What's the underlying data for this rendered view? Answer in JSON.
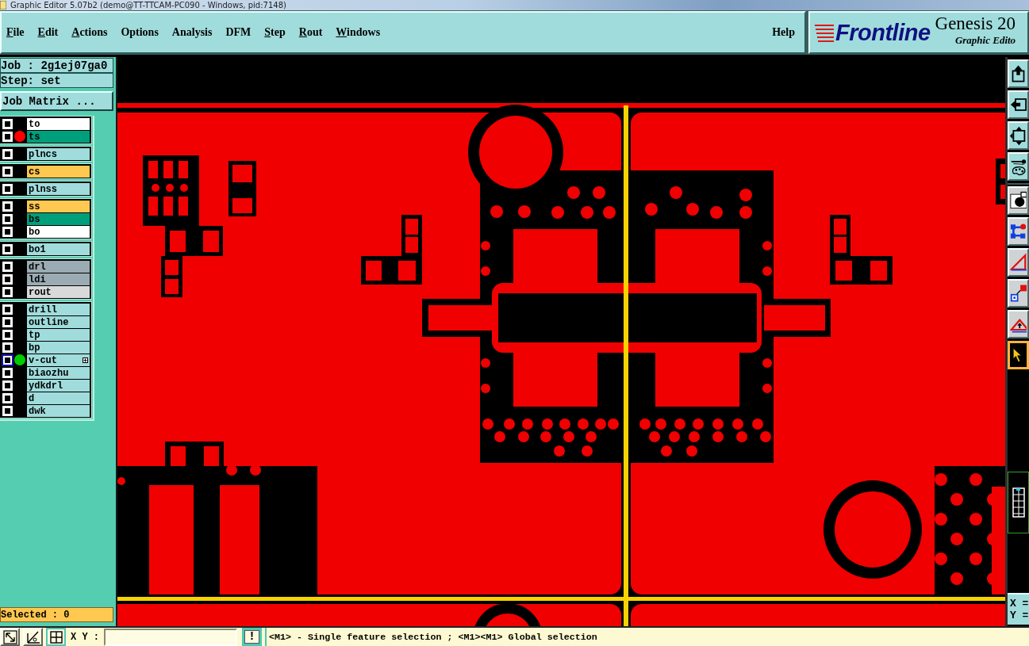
{
  "window": {
    "title": "Graphic Editor 5.07b2 (demo@TT-TTCAM-PC090 - Windows, pid:7148)"
  },
  "menu": [
    {
      "label": "File",
      "mnemonic": true
    },
    {
      "label": "Edit",
      "mnemonic": true
    },
    {
      "label": "Actions",
      "mnemonic": true
    },
    {
      "label": "Options",
      "mnemonic": false
    },
    {
      "label": "Analysis",
      "mnemonic": false
    },
    {
      "label": "DFM",
      "mnemonic": false
    },
    {
      "label": "Step",
      "mnemonic": true
    },
    {
      "label": "Rout",
      "mnemonic": true
    },
    {
      "label": "Windows",
      "mnemonic": true
    }
  ],
  "help_menu": {
    "label": "Help",
    "mnemonic": false
  },
  "logo": {
    "brand": "Frontline",
    "product": "Genesis 20",
    "subtitle": "Graphic Edito"
  },
  "job_label": "Job : 2g1ej07ga0",
  "step_label": "Step: set",
  "job_matrix_button": "Job Matrix ...",
  "layer_groups": [
    {
      "layers": [
        {
          "name": "to",
          "kind": "silk",
          "checked": false,
          "selected": false
        },
        {
          "name": "ts",
          "kind": "mask",
          "checked": false,
          "selected": false,
          "color": "#ff0000"
        }
      ]
    },
    {
      "layers": [
        {
          "name": "plncs",
          "kind": "doc",
          "checked": false,
          "selected": false
        }
      ]
    },
    {
      "layers": [
        {
          "name": "cs",
          "kind": "signal",
          "checked": false,
          "selected": false
        }
      ]
    },
    {
      "layers": [
        {
          "name": "plnss",
          "kind": "doc",
          "checked": false,
          "selected": false
        }
      ]
    },
    {
      "layers": [
        {
          "name": "ss",
          "kind": "signal",
          "checked": false,
          "selected": false
        },
        {
          "name": "bs",
          "kind": "mask",
          "checked": false,
          "selected": false
        },
        {
          "name": "bo",
          "kind": "silk",
          "checked": false,
          "selected": false
        }
      ]
    },
    {
      "layers": [
        {
          "name": "bo1",
          "kind": "doc",
          "checked": false,
          "selected": false
        }
      ]
    },
    {
      "layers": [
        {
          "name": "drl",
          "kind": "drill",
          "checked": false,
          "selected": false
        },
        {
          "name": "ldi",
          "kind": "drill",
          "checked": false,
          "selected": false
        },
        {
          "name": "rout",
          "kind": "rout",
          "checked": false,
          "selected": false
        }
      ]
    },
    {
      "layers": [
        {
          "name": "drill",
          "kind": "doc",
          "checked": false,
          "selected": false
        },
        {
          "name": "outline",
          "kind": "doc",
          "checked": false,
          "selected": false
        },
        {
          "name": "tp",
          "kind": "doc",
          "checked": false,
          "selected": false
        },
        {
          "name": "bp",
          "kind": "doc",
          "checked": false,
          "selected": false
        },
        {
          "name": "v-cut",
          "kind": "doc",
          "checked": false,
          "selected": true,
          "color": "#00cc00"
        },
        {
          "name": "biaozhu",
          "kind": "doc",
          "checked": false,
          "selected": false
        },
        {
          "name": "ydkdrl",
          "kind": "doc",
          "checked": false,
          "selected": false
        },
        {
          "name": "d",
          "kind": "doc",
          "checked": false,
          "selected": false
        },
        {
          "name": "dwk",
          "kind": "doc",
          "checked": false,
          "selected": false
        }
      ]
    }
  ],
  "selected_label": "Selected : 0",
  "tool_groups": [
    {
      "tools": [
        {
          "selected": false
        },
        {
          "selected": false
        },
        {
          "selected": false
        },
        {
          "selected": false
        }
      ]
    },
    {
      "tools": [
        {
          "selected": false
        },
        {
          "selected": false
        },
        {
          "selected": false
        },
        {
          "selected": false
        },
        {
          "selected": false
        },
        {
          "selected": true
        }
      ]
    }
  ],
  "coordinates": [
    "X =",
    "Y ="
  ],
  "bottom_bar": {
    "tools": [
      {
        "selected": false
      },
      {
        "selected": false
      },
      {
        "selected": true
      }
    ],
    "xy_label": "X Y :",
    "alert_button": "!",
    "message": "<M1> - Single feature selection ; <M1><M1> Global selection"
  }
}
